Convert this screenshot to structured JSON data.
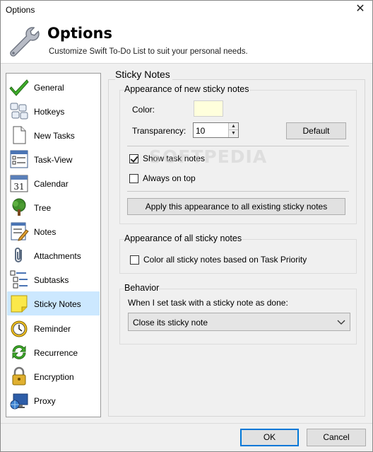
{
  "window": {
    "title": "Options"
  },
  "header": {
    "title": "Options",
    "subtitle": "Customize Swift To-Do List to suit your personal needs."
  },
  "sidebar": {
    "items": [
      {
        "label": "General",
        "icon": "checkmark-icon"
      },
      {
        "label": "Hotkeys",
        "icon": "keyboard-icon"
      },
      {
        "label": "New Tasks",
        "icon": "new-document-icon"
      },
      {
        "label": "Task-View",
        "icon": "task-view-icon"
      },
      {
        "label": "Calendar",
        "icon": "calendar-icon"
      },
      {
        "label": "Tree",
        "icon": "tree-icon"
      },
      {
        "label": "Notes",
        "icon": "notes-icon"
      },
      {
        "label": "Attachments",
        "icon": "paperclip-icon"
      },
      {
        "label": "Subtasks",
        "icon": "subtasks-icon"
      },
      {
        "label": "Sticky Notes",
        "icon": "sticky-note-icon",
        "selected": true
      },
      {
        "label": "Reminder",
        "icon": "alarm-clock-icon"
      },
      {
        "label": "Recurrence",
        "icon": "recurrence-icon"
      },
      {
        "label": "Encryption",
        "icon": "padlock-icon"
      },
      {
        "label": "Proxy",
        "icon": "monitor-globe-icon"
      }
    ],
    "calendar_day": "31"
  },
  "panel": {
    "title": "Sticky Notes",
    "appearance_new": {
      "title": "Appearance of new sticky notes",
      "color_label": "Color:",
      "color_value": "#ffffdc",
      "transparency_label": "Transparency:",
      "transparency_value": "10",
      "default_button": "Default",
      "show_task_notes_label": "Show task notes",
      "show_task_notes_checked": true,
      "always_on_top_label": "Always on top",
      "always_on_top_checked": false,
      "apply_button": "Apply this appearance to all existing sticky notes"
    },
    "appearance_all": {
      "title": "Appearance of all sticky notes",
      "color_by_priority_label": "Color all sticky notes based on Task Priority",
      "color_by_priority_checked": false
    },
    "behavior": {
      "title": "Behavior",
      "done_label": "When I set task with a sticky note as done:",
      "done_selected": "Close its sticky note"
    }
  },
  "watermark": "SOFTPEDIA",
  "footer": {
    "ok": "OK",
    "cancel": "Cancel"
  },
  "colors": {
    "selection": "#cce8ff",
    "accent": "#0078d7",
    "sticky": "#ffffdc"
  }
}
